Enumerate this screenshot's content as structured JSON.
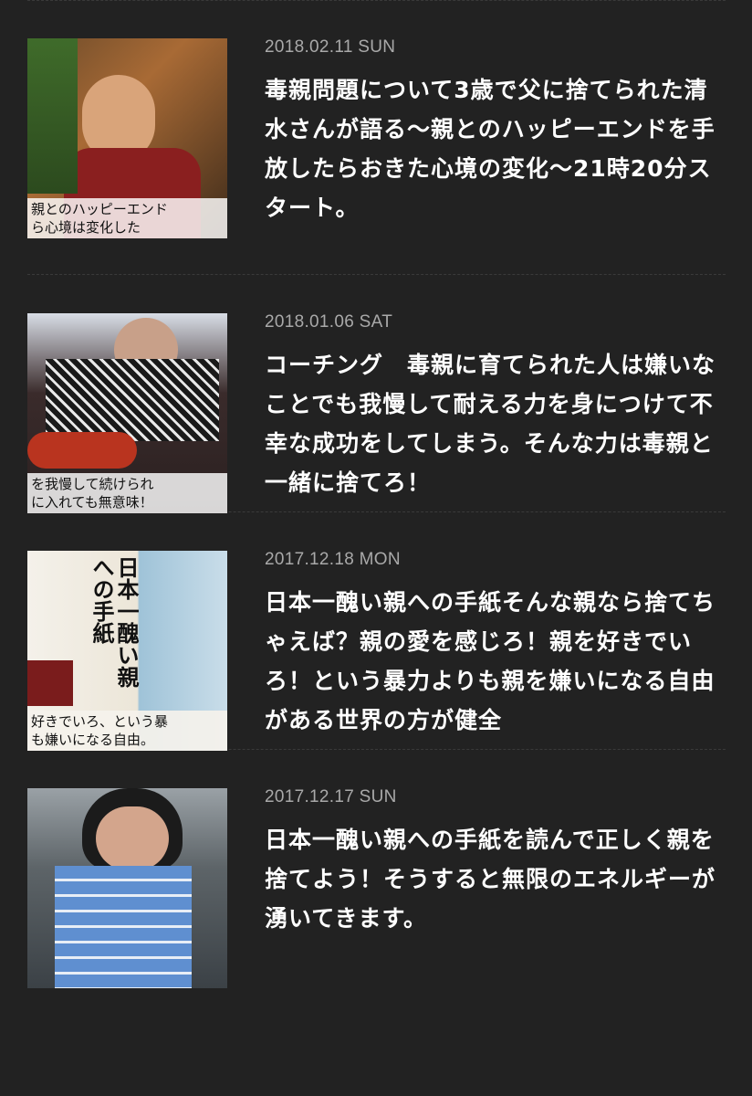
{
  "posts": [
    {
      "date": "2018.02.11 SUN",
      "title": "毒親問題について3歳で父に捨てられた清水さんが語る〜親とのハッピーエンドを手放したらおきた心境の変化〜21時20分スタート。",
      "thumb_lines": [
        "親とのハッピーエンド",
        "ら心境は変化した"
      ]
    },
    {
      "date": "2018.01.06 SAT",
      "title": "コーチング　毒親に育てられた人は嫌いなことでも我慢して耐える力を身につけて不幸な成功をしてしまう。そんな力は毒親と一緒に捨てろ！",
      "thumb_lines": [
        "を我慢して続けられ",
        "に入れても無意味！"
      ]
    },
    {
      "date": "2017.12.18 MON",
      "title": "日本一醜い親への手紙そんな親なら捨てちゃえば？親の愛を感じろ！親を好きでいろ！という暴力よりも親を嫌いになる自由がある世界の方が健全",
      "thumb_lines": [
        "好きでいろ、という暴",
        "も嫌いになる自由。"
      ],
      "thumb_book_title": "日本一醜い親への手紙"
    },
    {
      "date": "2017.12.17 SUN",
      "title": "日本一醜い親への手紙を読んで正しく親を捨てよう！そうすると無限のエネルギーが湧いてきます。"
    }
  ]
}
